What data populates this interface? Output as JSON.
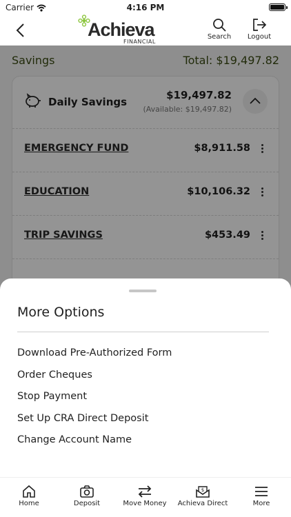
{
  "status_bar": {
    "carrier": "Carrier",
    "time": "4:16 PM"
  },
  "header": {
    "logo_text": "Achieva",
    "logo_subtext": "FINANCIAL",
    "search_label": "Search",
    "logout_label": "Logout"
  },
  "savings": {
    "title": "Savings",
    "total": "Total: $19,497.82",
    "account": {
      "name": "Daily Savings",
      "amount": "$19,497.82",
      "available": "(Available: $19,497.82)"
    },
    "sub_accounts": [
      {
        "name": "EMERGENCY FUND",
        "amount": "$8,911.58"
      },
      {
        "name": "EDUCATION",
        "amount": "$10,106.32"
      },
      {
        "name": "TRIP SAVINGS",
        "amount": "$453.49"
      }
    ]
  },
  "sheet": {
    "title": "More Options",
    "options": [
      "Download Pre-Authorized Form",
      "Order Cheques",
      "Stop Payment",
      "Set Up CRA Direct Deposit",
      "Change Account Name"
    ]
  },
  "tabs": [
    {
      "label": "Home",
      "icon": "home-icon"
    },
    {
      "label": "Deposit",
      "icon": "camera-icon"
    },
    {
      "label": "Move Money",
      "icon": "transfer-arrows-icon"
    },
    {
      "label": "Achieva Direct",
      "icon": "dollar-envelope-icon"
    },
    {
      "label": "More",
      "icon": "menu-icon"
    }
  ],
  "colors": {
    "accent_green": "#3a4a12",
    "logo_green": "#8dc63f"
  }
}
